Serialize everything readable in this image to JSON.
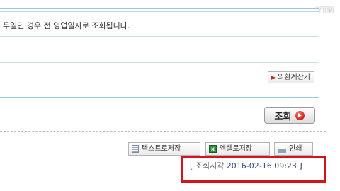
{
  "info": {
    "notice": "두일인 경우 전 영업일자로 조회됩니다.",
    "fx_calc_label": "외환계산기"
  },
  "search": {
    "button_label": "조회"
  },
  "toolbar": {
    "text_save_label": "텍스트로저장",
    "excel_save_label": "엑셀로저장",
    "print_label": "인쇄"
  },
  "timestamp": {
    "open_bracket": "[",
    "label": "조회시각",
    "value": "2016-02-16 09:23",
    "close_bracket": "]"
  },
  "watermark": "YTN"
}
